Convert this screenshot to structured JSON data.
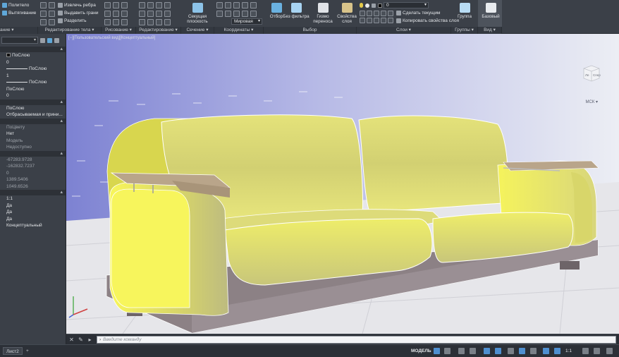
{
  "ribbon": {
    "panels": {
      "solid_editing": "Редактирование тела",
      "drawing": "Рисование",
      "modify": "Редактирование",
      "section": "Сечение",
      "coordinates": "Координаты",
      "selection": "Выбор",
      "layers": "Слои",
      "groups": "Группы",
      "view": "Вид"
    },
    "left_tools": {
      "polysolid": "Политело",
      "extrude": "Вытягивание"
    },
    "solid_editing_tools": {
      "extract_edges": "Извлечь ребра",
      "extrude_faces": "Выдавить грани",
      "separate": "Разделить"
    },
    "section_plane": "Секущая плоскость",
    "ucs_dropdown": "Мировая",
    "culling": "Отбор",
    "no_filter": "Без фильтра",
    "gizmo": "Гизмо переноса",
    "layer_properties": "Свойства слоя",
    "layer_dropdown": "0",
    "make_current": "Сделать текущим",
    "match_layer": "Копировать свойства слоя",
    "group": "Группа",
    "base_view": "Базовый"
  },
  "properties": {
    "general_rows": [
      "ПоСлою",
      "0",
      "ПоСлою",
      "1",
      "ПоСлою",
      "ПоСлою",
      "0"
    ],
    "visuals_rows": [
      "ПоСлою",
      "Отбрасываемая и прини..."
    ],
    "plot_rows": [
      "ПоЦвету",
      "Нет",
      "Модель",
      "Недоступно"
    ],
    "geometry_rows": [
      "-67283.9728",
      "-162832.7237",
      "0",
      "1389.5406",
      "1049.6526"
    ],
    "misc_rows": [
      "1:1",
      "Да",
      "Да",
      "Да",
      "Концептуальный"
    ]
  },
  "viewport": {
    "label": "[−][Пользовательский вид][Концептуальный]",
    "viewcube_left": "Ле",
    "viewcube_right": "Спер",
    "wcs": "МСК"
  },
  "commandline": {
    "placeholder": "Введите команду"
  },
  "statusbar": {
    "layout_tab": "Лист2",
    "add_tab": "+",
    "model": "МОДЕЛЬ",
    "scale": "1:1"
  },
  "colors": {
    "sofa_body": "#f4f25a",
    "sofa_base": "#8c8185",
    "armrest_wood": "#b9a58a",
    "sky_left": "#8a8fd6",
    "floor": "#e7e7ea"
  }
}
